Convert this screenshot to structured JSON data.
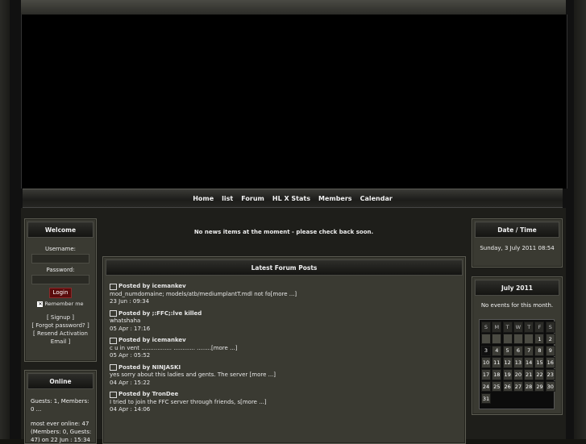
{
  "nav": [
    "Home",
    "list",
    "Forum",
    "HL X Stats",
    "Members",
    "Calendar"
  ],
  "welcome": {
    "title": "Welcome",
    "username_label": "Username:",
    "password_label": "Password:",
    "login_button": "Login",
    "remember_label": "Remember me",
    "signup_link": "[ Signup ]",
    "forgot_link": "[ Forgot password? ]",
    "resend_link_1": "[ Resend Activation",
    "resend_link_2": "Email ]"
  },
  "online": {
    "title": "Online",
    "guests_line1": "Guests: 1, Members:",
    "guests_line2": "0 ...",
    "most_line1": "most ever online: 47",
    "most_line2": "(Members: 0, Guests:",
    "most_line3": "47) on 22 Jun : 15:34"
  },
  "news": {
    "message": "No news items at the moment - please check back soon."
  },
  "forum": {
    "title": "Latest Forum Posts",
    "posts": [
      {
        "author": "Posted by icemankev",
        "text": "mod_numdomaine; models/atb/mediumplantT.mdl not fo[more ...]",
        "date": "23 Jun : 09:34"
      },
      {
        "author": "Posted by ;:FFC;:lve killed",
        "text": "whatshaha",
        "date": "05 Apr : 17:16"
      },
      {
        "author": "Posted by icemankev",
        "text": "c u in vent ................. ............ ........[more ...]",
        "date": "05 Apr : 05:52"
      },
      {
        "author": "Posted by NINJASKI",
        "text": "yes sorry about this ladies and gents. The server [more ...]",
        "date": "04 Apr : 15:22"
      },
      {
        "author": "Posted by TronDee",
        "text": "I tried to join the FFC server through friends, s[more ...]",
        "date": "04 Apr : 14:06"
      }
    ]
  },
  "datetime": {
    "title": "Date / Time",
    "value": "Sunday, 3 July 2011 08:54"
  },
  "calendar": {
    "title": "July 2011",
    "no_events": "No events for this month.",
    "weekdays": [
      "S",
      "M",
      "T",
      "W",
      "T",
      "F",
      "S"
    ],
    "leading_blanks": 5,
    "days": 31,
    "today": 3
  }
}
